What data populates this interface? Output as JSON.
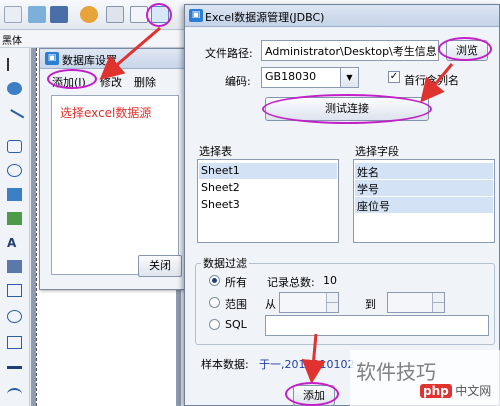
{
  "app": {
    "font_label": "黑体"
  },
  "db_window": {
    "title": "数据库设置",
    "menu": {
      "add": "添加(",
      "add_key": "I",
      "add_close": ")",
      "modify": "修改",
      "delete": "删除"
    },
    "list_item": "选择excel数据源",
    "close_label": "关闭"
  },
  "excel_window": {
    "title": "Excel数据源管理(JDBC)",
    "file_path_label": "文件路径:",
    "file_path_value": "Administrator\\Desktop\\考生信息.xls",
    "browse_label": "浏览",
    "encoding_label": "编码:",
    "encoding_value": "GB18030",
    "header_checkbox_label": "首行含列名",
    "header_checkbox_checked": true,
    "test_conn_label": "测试连接",
    "select_table_label": "选择表",
    "tables": [
      "Sheet1",
      "Sheet2",
      "Sheet3"
    ],
    "select_field_label": "选择字段",
    "fields": [
      "姓名",
      "学号",
      "座位号"
    ],
    "filter_group_label": "数据过滤",
    "filter_all_label": "所有",
    "record_total_label": "记录总数:",
    "record_total_value": "10",
    "filter_range_label": "范围",
    "from_label": "从",
    "to_label": "到",
    "filter_sql_label": "SQL",
    "sample_label": "样本数据:",
    "sample_value": "于一,2019010102",
    "add_label": "添加"
  },
  "watermark": {
    "text": "软件技巧",
    "logo_text": "php",
    "logo_suffix": "中文网"
  },
  "colors": {
    "annotation": "#c21fc7",
    "arrow": "#e0322e",
    "selected_row": "#d3e2f5",
    "list_item_text": "#e0322e"
  }
}
